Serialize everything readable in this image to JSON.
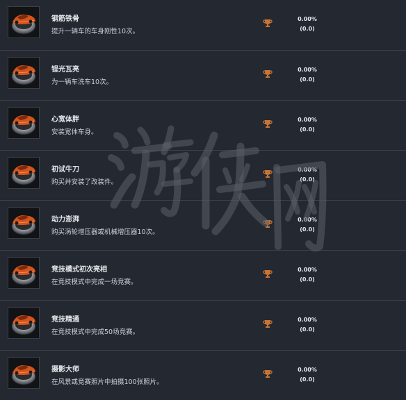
{
  "achievements": [
    {
      "title": "钢筋铁骨",
      "description": "提升一辆车的车身刚性10次。",
      "percent": "0.00%",
      "count": "(0.0)",
      "icon": "car-badge-icon",
      "trophy": "bronze-trophy-icon"
    },
    {
      "title": "锃光瓦亮",
      "description": "为一辆车洗车10次。",
      "percent": "0.00%",
      "count": "(0.0)",
      "icon": "car-badge-icon",
      "trophy": "bronze-trophy-icon"
    },
    {
      "title": "心宽体胖",
      "description": "安装宽体车身。",
      "percent": "0.00%",
      "count": "(0.0)",
      "icon": "car-badge-icon",
      "trophy": "bronze-trophy-icon"
    },
    {
      "title": "初试牛刀",
      "description": "购买并安装了改装件。",
      "percent": "0.00%",
      "count": "(0.0)",
      "icon": "car-badge-icon",
      "trophy": "bronze-trophy-icon"
    },
    {
      "title": "动力澎湃",
      "description": "购买涡轮增压器或机械增压器10次。",
      "percent": "0.00%",
      "count": "(0.0)",
      "icon": "car-badge-icon",
      "trophy": "bronze-trophy-icon"
    },
    {
      "title": "竞技模式初次亮相",
      "description": "在竞技模式中完成一场竞赛。",
      "percent": "0.00%",
      "count": "(0.0)",
      "icon": "car-badge-icon",
      "trophy": "bronze-trophy-icon"
    },
    {
      "title": "竞技精通",
      "description": "在竞技模式中完成50场竞赛。",
      "percent": "0.00%",
      "count": "(0.0)",
      "icon": "car-badge-icon",
      "trophy": "bronze-trophy-icon"
    },
    {
      "title": "摄影大师",
      "description": "在风景或竞赛照片中拍摄100张照片。",
      "percent": "0.00%",
      "count": "(0.0)",
      "icon": "car-badge-icon",
      "trophy": "bronze-trophy-icon"
    }
  ],
  "watermark": {
    "text": "游侠网",
    "icon": "site-watermark"
  },
  "colors": {
    "background": "#1f232b",
    "row_background": "#242831",
    "separator": "#3a3f49",
    "trophy_bronze": "#c87533",
    "car_orange": "#d4541c"
  }
}
